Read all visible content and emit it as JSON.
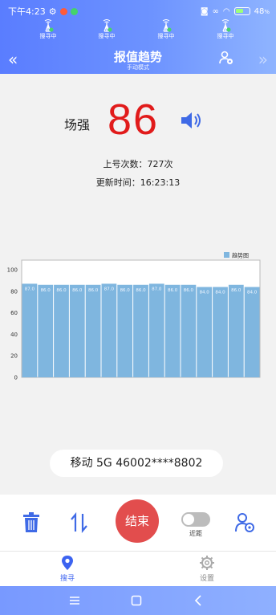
{
  "status_bar": {
    "time": "下午4:23",
    "battery_text": "48",
    "battery_unit": "%"
  },
  "towers": {
    "labels": [
      "搜寻中",
      "搜寻中",
      "搜寻中",
      "搜寻中"
    ]
  },
  "nav": {
    "title": "报值趋势",
    "subtitle": "手动模式",
    "back_glyph": "«",
    "forward_glyph": "»"
  },
  "strength": {
    "label": "场强",
    "value": "86"
  },
  "stats": {
    "count_text": "上号次数：727次",
    "updated_text": "更新时间：16:23:13"
  },
  "chart_data": {
    "type": "bar",
    "title": "",
    "legend": [
      "趋势图"
    ],
    "legend_position": "top-right",
    "ylim": [
      0,
      100
    ],
    "yticks": [
      0,
      20,
      40,
      60,
      80,
      100
    ],
    "series": [
      {
        "name": "趋势图",
        "values": [
          87,
          86,
          86,
          86,
          86,
          87,
          86,
          86,
          87,
          86,
          86,
          84,
          84,
          86,
          84
        ],
        "labels": [
          "87.0",
          "86.0",
          "86.0",
          "86.0",
          "86.0",
          "87.0",
          "86.0",
          "86.0",
          "87.0",
          "86.0",
          "86.0",
          "84.0",
          "84.0",
          "86.0",
          "84.0"
        ]
      }
    ],
    "color": "#7fb6df",
    "grid": false
  },
  "carrier": {
    "text": "移动 5G 46002****8802"
  },
  "toolbar": {
    "end_label": "结束",
    "toggle_label": "近距",
    "toggle_on": false
  },
  "tabs": {
    "search_label": "搜寻",
    "settings_label": "设置",
    "active_color": "#3c63f0",
    "inactive_color": "#888888"
  },
  "colors": {
    "accent": "#5a7dff",
    "strength": "#e11b1b",
    "end_button": "#e24d4d",
    "icon_blue": "#3f6ae6"
  }
}
